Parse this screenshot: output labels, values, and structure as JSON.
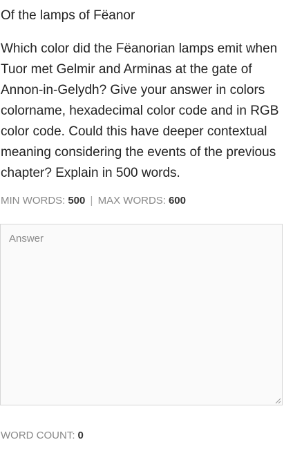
{
  "title": "Of the lamps of Fëanor",
  "question": "Which color did the Fëanorian lamps emit when Tuor met Gelmir and Arminas at the gate of Annon-in-Gelydh? Give your answer in colors colorname, hexadecimal color code and in RGB color code. Could this have deeper contextual meaning considering the events of the previous chapter? Explain in 500 words.",
  "limits": {
    "min_label": "MIN WORDS:",
    "min_value": "500",
    "separator": "|",
    "max_label": "MAX WORDS:",
    "max_value": "600"
  },
  "answer": {
    "placeholder": "Answer",
    "value": ""
  },
  "word_count": {
    "label": "WORD COUNT:",
    "value": "0"
  }
}
